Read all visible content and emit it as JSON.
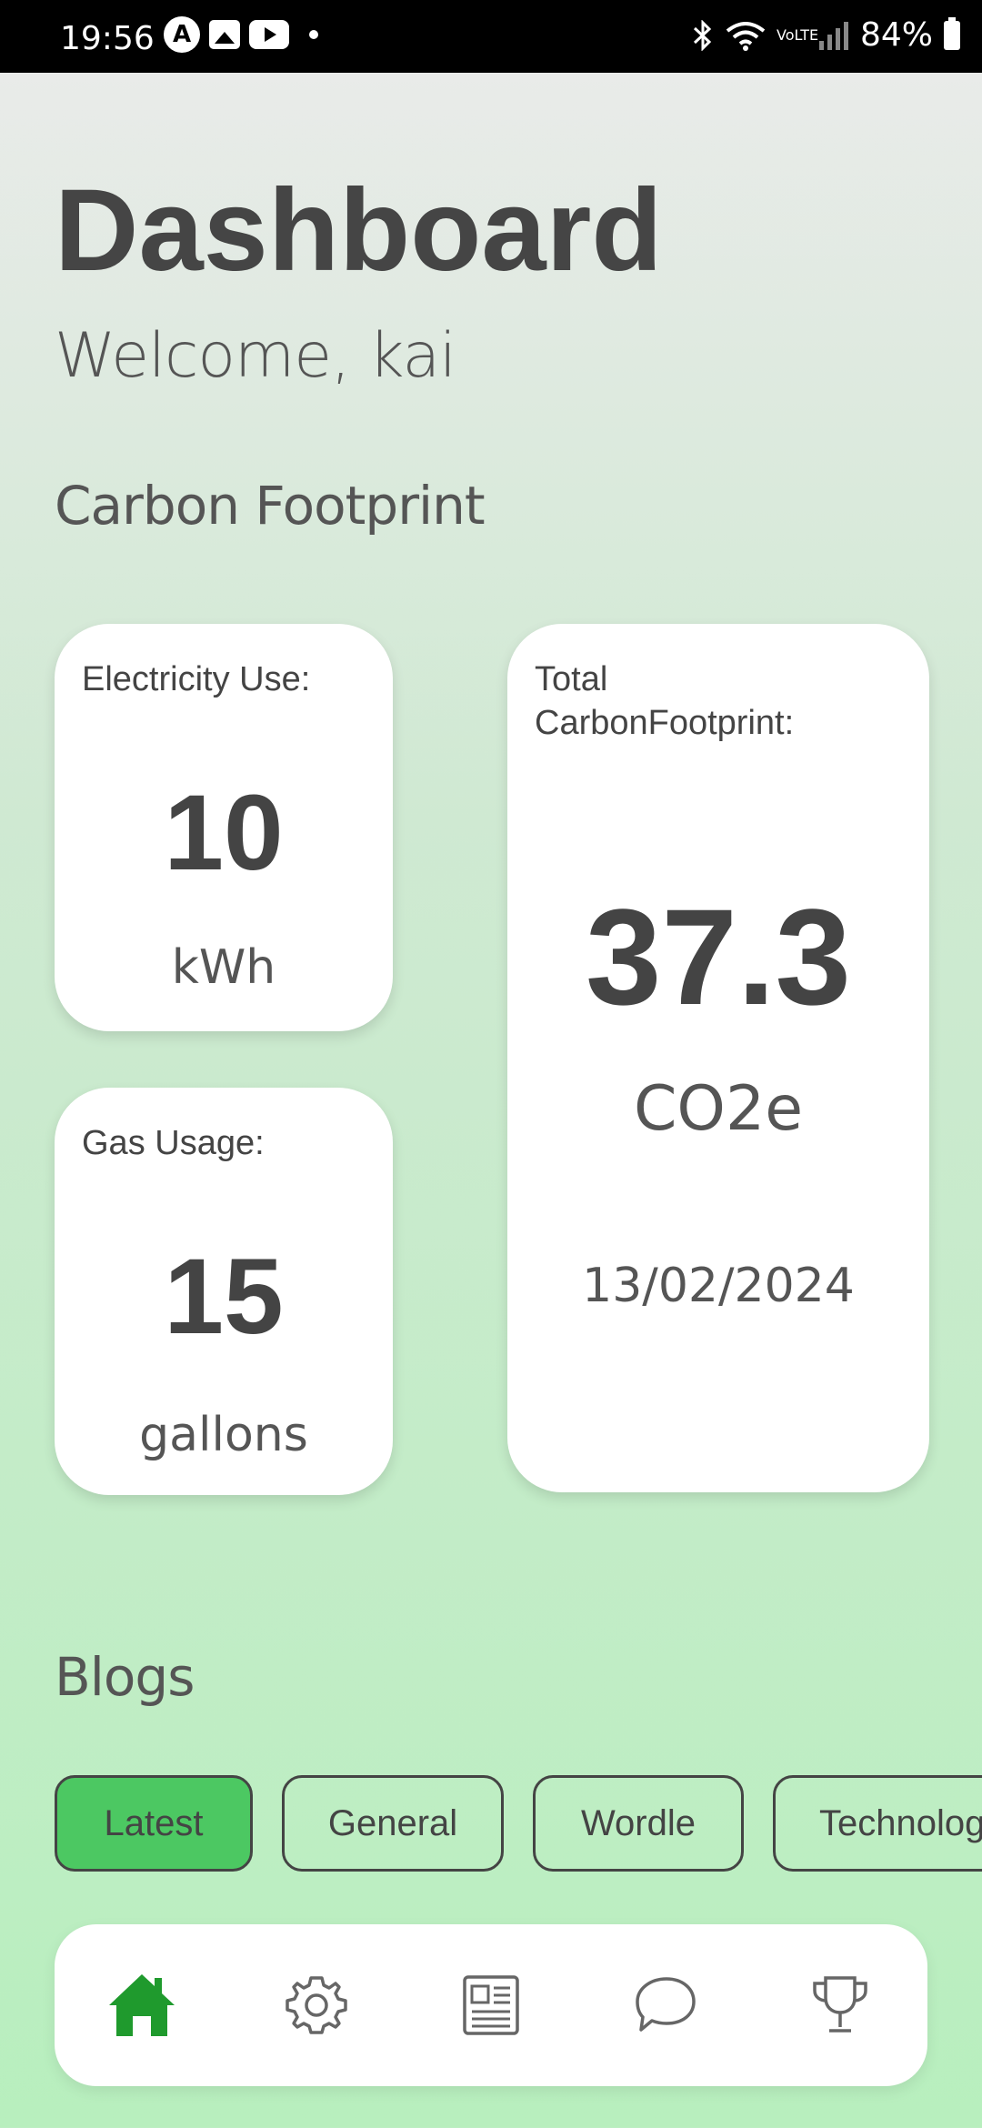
{
  "status_bar": {
    "time": "19:56",
    "battery": "84%",
    "network": "VoLTE"
  },
  "header": {
    "title": "Dashboard",
    "welcome": "Welcome, kai"
  },
  "carbon": {
    "section_title": "Carbon Footprint",
    "electricity": {
      "label": "Electricity Use:",
      "value": "10",
      "unit": "kWh"
    },
    "gas": {
      "label": "Gas Usage:",
      "value": "15",
      "unit": "gallons"
    },
    "total": {
      "label": "Total CarbonFootprint:",
      "value": "37.3",
      "unit": "CO2e",
      "date": "13/02/2024"
    }
  },
  "blogs": {
    "section_title": "Blogs",
    "tabs": [
      {
        "label": "Latest",
        "active": true
      },
      {
        "label": "General",
        "active": false
      },
      {
        "label": "Wordle",
        "active": false
      },
      {
        "label": "Technology",
        "active": false
      }
    ]
  },
  "nav": {
    "items": [
      {
        "icon": "home-icon",
        "active": true
      },
      {
        "icon": "gear-icon",
        "active": false
      },
      {
        "icon": "newspaper-icon",
        "active": false
      },
      {
        "icon": "chat-icon",
        "active": false
      },
      {
        "icon": "trophy-icon",
        "active": false
      }
    ],
    "active_color": "#1f9a2d",
    "inactive_color": "#666666"
  }
}
